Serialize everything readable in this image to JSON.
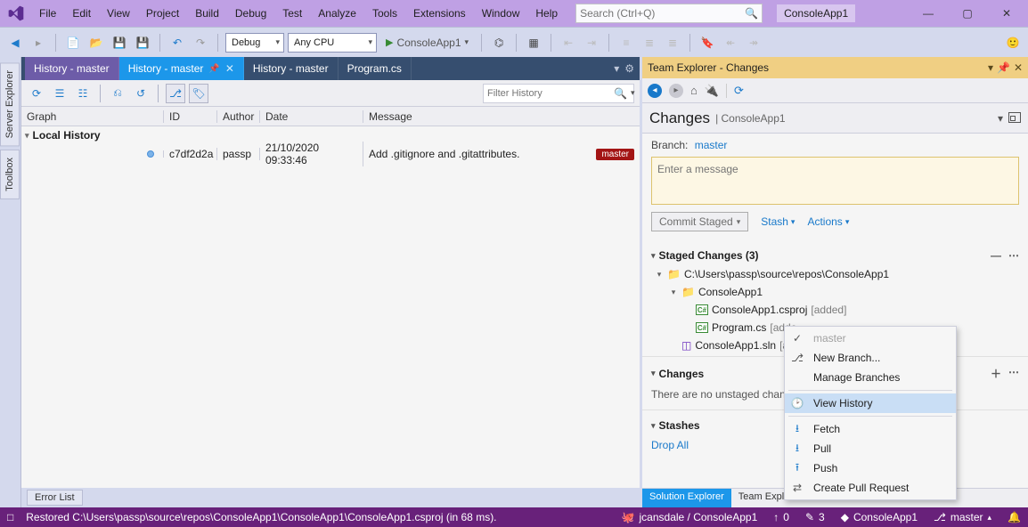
{
  "menu": [
    "File",
    "Edit",
    "View",
    "Project",
    "Build",
    "Debug",
    "Test",
    "Analyze",
    "Tools",
    "Extensions",
    "Window",
    "Help"
  ],
  "title_search_placeholder": "Search (Ctrl+Q)",
  "solution_name": "ConsoleApp1",
  "toolbar": {
    "config": "Debug",
    "platform": "Any CPU",
    "run_target": "ConsoleApp1"
  },
  "left_tabs": [
    "Server Explorer",
    "Toolbox"
  ],
  "doc_tabs": [
    {
      "label": "History - master",
      "selected": true,
      "pinned": false
    },
    {
      "label": "History - master",
      "selected": false,
      "pinned": true,
      "blue": true
    },
    {
      "label": "History - master",
      "selected": false,
      "pinned": false
    },
    {
      "label": "Program.cs",
      "selected": false,
      "pinned": false
    }
  ],
  "history": {
    "filter_placeholder": "Filter History",
    "columns": {
      "graph": "Graph",
      "id": "ID",
      "author": "Author",
      "date": "Date",
      "message": "Message"
    },
    "group": "Local History",
    "commits": [
      {
        "id": "c7df2d2a",
        "author": "passp",
        "date": "21/10/2020 09:33:46",
        "message": "Add .gitignore and .gitattributes.",
        "branch": "master"
      }
    ]
  },
  "error_list_tab": "Error List",
  "team_explorer": {
    "title": "Team Explorer - Changes",
    "page": "Changes",
    "repo": "ConsoleApp1",
    "branch_label": "Branch:",
    "branch": "master",
    "message_placeholder": "Enter a message",
    "commit_button": "Commit Staged",
    "stash": "Stash",
    "actions": "Actions",
    "staged_header": "Staged Changes (3)",
    "tree": {
      "root": "C:\\Users\\passp\\source\\repos\\ConsoleApp1",
      "proj": "ConsoleApp1",
      "files": [
        {
          "name": "ConsoleApp1.csproj",
          "status": "[added]",
          "kind": "cs"
        },
        {
          "name": "Program.cs",
          "status": "[adde",
          "kind": "cs"
        }
      ],
      "sln": {
        "name": "ConsoleApp1.sln",
        "status": "[ad"
      }
    },
    "changes_header": "Changes",
    "changes_note": "There are no unstaged changes",
    "stashes_header": "Stashes",
    "drop_all": "Drop All",
    "bottom_tabs": {
      "solexp": "Solution Explorer",
      "teamexp": "Team Explore"
    }
  },
  "context_menu": {
    "disabled": "master",
    "new_branch": "New Branch...",
    "manage": "Manage Branches",
    "view_history": "View History",
    "fetch": "Fetch",
    "pull": "Pull",
    "push": "Push",
    "create_pr": "Create Pull Request"
  },
  "statusbar": {
    "icon": "□",
    "msg": "Restored C:\\Users\\passp\\source\\repos\\ConsoleApp1\\ConsoleApp1\\ConsoleApp1.csproj (in 68 ms).",
    "user": "jcansdale / ConsoleApp1",
    "up": "0",
    "pencil": "3",
    "repo": "ConsoleApp1",
    "branch": "master"
  }
}
